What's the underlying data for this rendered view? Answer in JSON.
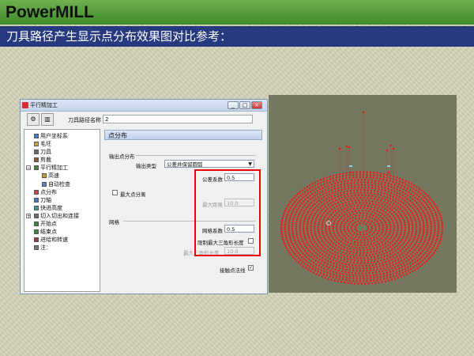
{
  "slide": {
    "title": "PowerMILL",
    "subtitle": "刀具路径产生显示点分布效果图对比参考："
  },
  "dialog": {
    "window_title": "平行精加工",
    "toolpath_name_label": "刀具路径名称",
    "toolpath_name_value": "2",
    "window_buttons": {
      "minimize": "_",
      "maximize": "□",
      "close": "×"
    },
    "tree": [
      {
        "label": "用户坐标系",
        "icon": "coordinate-system-icon",
        "indent": 1
      },
      {
        "label": "毛坯",
        "icon": "block-icon",
        "indent": 1
      },
      {
        "label": "刀具",
        "icon": "tool-icon",
        "indent": 1
      },
      {
        "label": "剪裁",
        "icon": "trim-icon",
        "indent": 1
      },
      {
        "label": "平行精加工",
        "icon": "parallel-finish-icon",
        "indent": 1,
        "expanded": true
      },
      {
        "label": "高速",
        "icon": "high-speed-icon",
        "indent": 2
      },
      {
        "label": "自动检查",
        "icon": "auto-check-icon",
        "indent": 2
      },
      {
        "label": "点分布",
        "icon": "point-distribution-icon",
        "indent": 1
      },
      {
        "label": "刀轴",
        "icon": "tool-axis-icon",
        "indent": 1
      },
      {
        "label": "快进高度",
        "icon": "rapid-height-icon",
        "indent": 1
      },
      {
        "label": "切入切出和连接",
        "icon": "leads-links-icon",
        "indent": 1,
        "collapsed": true
      },
      {
        "label": "开始点",
        "icon": "start-point-icon",
        "indent": 1
      },
      {
        "label": "结束点",
        "icon": "end-point-icon",
        "indent": 1
      },
      {
        "label": "进给和转速",
        "icon": "feeds-speeds-icon",
        "indent": 1
      },
      {
        "label": "注：",
        "icon": "notes-icon",
        "indent": 1
      }
    ],
    "panel": {
      "header": "点分布",
      "output_group_label": "输出点分布",
      "output_type_label": "输出类型",
      "output_type_value": "公差并保留圆弧",
      "tolerance_factor_label": "公差系数",
      "tolerance_factor_value": "0.5",
      "max_point_sep_checkbox_label": "最大点分离",
      "max_point_sep_checked": false,
      "max_distance_label": "最大距离",
      "max_distance_value": "10.0",
      "mesh_group_label": "网格",
      "mesh_factor_label": "网格系数",
      "mesh_factor_value": "0.5",
      "limit_triangle_label": "限制最大三角形长度",
      "limit_triangle_checked": false,
      "max_triangle_length_label": "最大三角形长度",
      "max_triangle_length_value": "10.0",
      "contact_normal_label": "接触点法线",
      "contact_normal_checked": true,
      "check_mark": "✓"
    }
  },
  "colors": {
    "title_bar": "#4e9a3a",
    "subtitle_bar": "#283a7f",
    "viewport_bg": "#757760",
    "points": "#e02020",
    "highlight_box": "#e00000"
  }
}
